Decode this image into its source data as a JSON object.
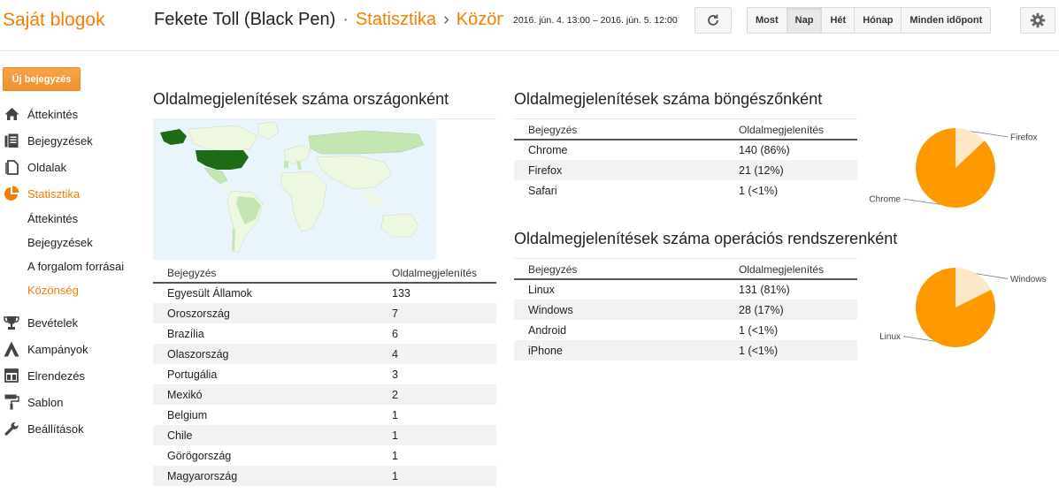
{
  "header": {
    "app_title": "Saját blogok",
    "blog_name": "Fekete Toll (Black Pen)",
    "sep1": "·",
    "crumb_stats": "Statisztika",
    "sep2": "›",
    "crumb_current": "Közönség",
    "date_range": "2016. jún. 4. 13:00 – 2016. jún. 5. 12:00",
    "ranges": [
      {
        "label": "Most",
        "active": false
      },
      {
        "label": "Nap",
        "active": true
      },
      {
        "label": "Hét",
        "active": false
      },
      {
        "label": "Hónap",
        "active": false
      },
      {
        "label": "Minden időpont",
        "active": false
      }
    ]
  },
  "sidebar": {
    "new_post": "Új bejegyzés",
    "items": [
      {
        "label": "Áttekintés",
        "icon": "home-icon"
      },
      {
        "label": "Bejegyzések",
        "icon": "posts-icon"
      },
      {
        "label": "Oldalak",
        "icon": "pages-icon"
      },
      {
        "label": "Statisztika",
        "icon": "stats-pie-icon"
      },
      {
        "label": "Bevételek",
        "icon": "trophy-icon"
      },
      {
        "label": "Kampányok",
        "icon": "campaign-icon"
      },
      {
        "label": "Elrendezés",
        "icon": "layout-icon"
      },
      {
        "label": "Sablon",
        "icon": "paint-roller-icon"
      },
      {
        "label": "Beállítások",
        "icon": "wrench-icon"
      }
    ],
    "sub_items": [
      {
        "label": "Áttekintés",
        "active": false
      },
      {
        "label": "Bejegyzések",
        "active": false
      },
      {
        "label": "A forgalom forrásai",
        "active": false
      },
      {
        "label": "Közönség",
        "active": true
      }
    ]
  },
  "countries": {
    "title": "Oldalmegjelenítések száma országonként",
    "col1": "Bejegyzés",
    "col2": "Oldalmegjelenítés",
    "rows": [
      {
        "name": "Egyesült Államok",
        "value": "133"
      },
      {
        "name": "Oroszország",
        "value": "7"
      },
      {
        "name": "Brazília",
        "value": "6"
      },
      {
        "name": "Olaszország",
        "value": "4"
      },
      {
        "name": "Portugália",
        "value": "3"
      },
      {
        "name": "Mexikó",
        "value": "2"
      },
      {
        "name": "Belgium",
        "value": "1"
      },
      {
        "name": "Chile",
        "value": "1"
      },
      {
        "name": "Görögország",
        "value": "1"
      },
      {
        "name": "Magyarország",
        "value": "1"
      }
    ]
  },
  "browsers": {
    "title": "Oldalmegjelenítések száma böngészőnként",
    "col1": "Bejegyzés",
    "col2": "Oldalmegjelenítés",
    "rows": [
      {
        "name": "Chrome",
        "value": "140 (86%)"
      },
      {
        "name": "Firefox",
        "value": "21 (12%)"
      },
      {
        "name": "Safari",
        "value": "1 (<1%)"
      }
    ]
  },
  "os": {
    "title": "Oldalmegjelenítések száma operációs rendszerenként",
    "col1": "Bejegyzés",
    "col2": "Oldalmegjelenítés",
    "rows": [
      {
        "name": "Linux",
        "value": "131 (81%)"
      },
      {
        "name": "Windows",
        "value": "28 (17%)"
      },
      {
        "name": "Android",
        "value": "1 (<1%)"
      },
      {
        "name": "iPhone",
        "value": "1 (<1%)"
      }
    ]
  },
  "chart_data": [
    {
      "type": "pie",
      "categories": [
        "Chrome",
        "Firefox"
      ],
      "values": [
        140,
        21
      ],
      "labels": [
        "Chrome",
        "Firefox"
      ],
      "colors": [
        "#ff9900",
        "#fce8c7"
      ]
    },
    {
      "type": "pie",
      "categories": [
        "Linux",
        "Windows"
      ],
      "values": [
        131,
        28
      ],
      "labels": [
        "Linux",
        "Windows"
      ],
      "colors": [
        "#ff9900",
        "#fce8c7"
      ]
    }
  ],
  "colors": {
    "accent": "#f57d00",
    "map_highlight": "#1e6a16",
    "map_medium": "#c4e6b3",
    "map_light": "#eef7df"
  }
}
